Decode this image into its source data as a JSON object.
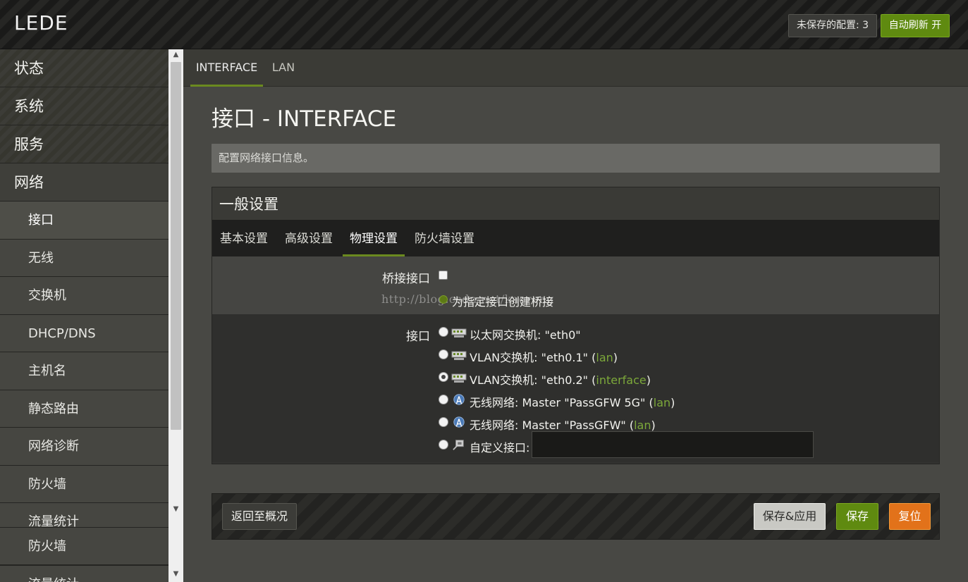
{
  "header": {
    "brand": "LEDE",
    "unsaved_label": "未保存的配置: 3",
    "autorefresh_label": "自动刷新 开"
  },
  "sidebar": {
    "items": [
      {
        "label": "状态"
      },
      {
        "label": "系统"
      },
      {
        "label": "服务"
      },
      {
        "label": "网络"
      }
    ],
    "network_sub": [
      {
        "label": "接口"
      },
      {
        "label": "无线"
      },
      {
        "label": "交换机"
      },
      {
        "label": "DHCP/DNS"
      },
      {
        "label": "主机名"
      },
      {
        "label": "静态路由"
      },
      {
        "label": "网络诊断"
      },
      {
        "label": "防火墙"
      },
      {
        "label": "流量统计"
      }
    ],
    "bottom": [
      {
        "label": "防火墙"
      },
      {
        "label": "流量统计"
      }
    ]
  },
  "toptabs": [
    {
      "label": "INTERFACE"
    },
    {
      "label": "LAN"
    }
  ],
  "page": {
    "title": "接口 - INTERFACE",
    "description": "配置网络接口信息。"
  },
  "section": {
    "title": "一般设置",
    "tabs": [
      {
        "label": "基本设置"
      },
      {
        "label": "高级设置"
      },
      {
        "label": "物理设置"
      },
      {
        "label": "防火墙设置"
      }
    ],
    "bridge": {
      "label": "桥接接口",
      "help": "为指定接口创建桥接",
      "watermark": "http://blog.csdn.net/kaorong"
    },
    "interface": {
      "label": "接口",
      "options": [
        {
          "prefix": "以太网交换机: \"eth0\"",
          "net": "",
          "suffix": ""
        },
        {
          "prefix": "VLAN交换机: \"eth0.1\" (",
          "net": "lan",
          "suffix": ")"
        },
        {
          "prefix": "VLAN交换机: \"eth0.2\" (",
          "net": "interface",
          "suffix": ")"
        },
        {
          "prefix": "无线网络: Master \"PassGFW 5G\" (",
          "net": "lan",
          "suffix": ")"
        },
        {
          "prefix": "无线网络: Master \"PassGFW\" (",
          "net": "lan",
          "suffix": ")"
        },
        {
          "prefix": "自定义接口:",
          "net": "",
          "suffix": ""
        }
      ]
    }
  },
  "actions": {
    "back": "返回至概况",
    "save_apply": "保存&应用",
    "save": "保存",
    "reset": "复位"
  },
  "colors": {
    "accent_green": "#5f8a10",
    "reset_orange": "#e2721a",
    "net_link": "#7ca83a"
  }
}
